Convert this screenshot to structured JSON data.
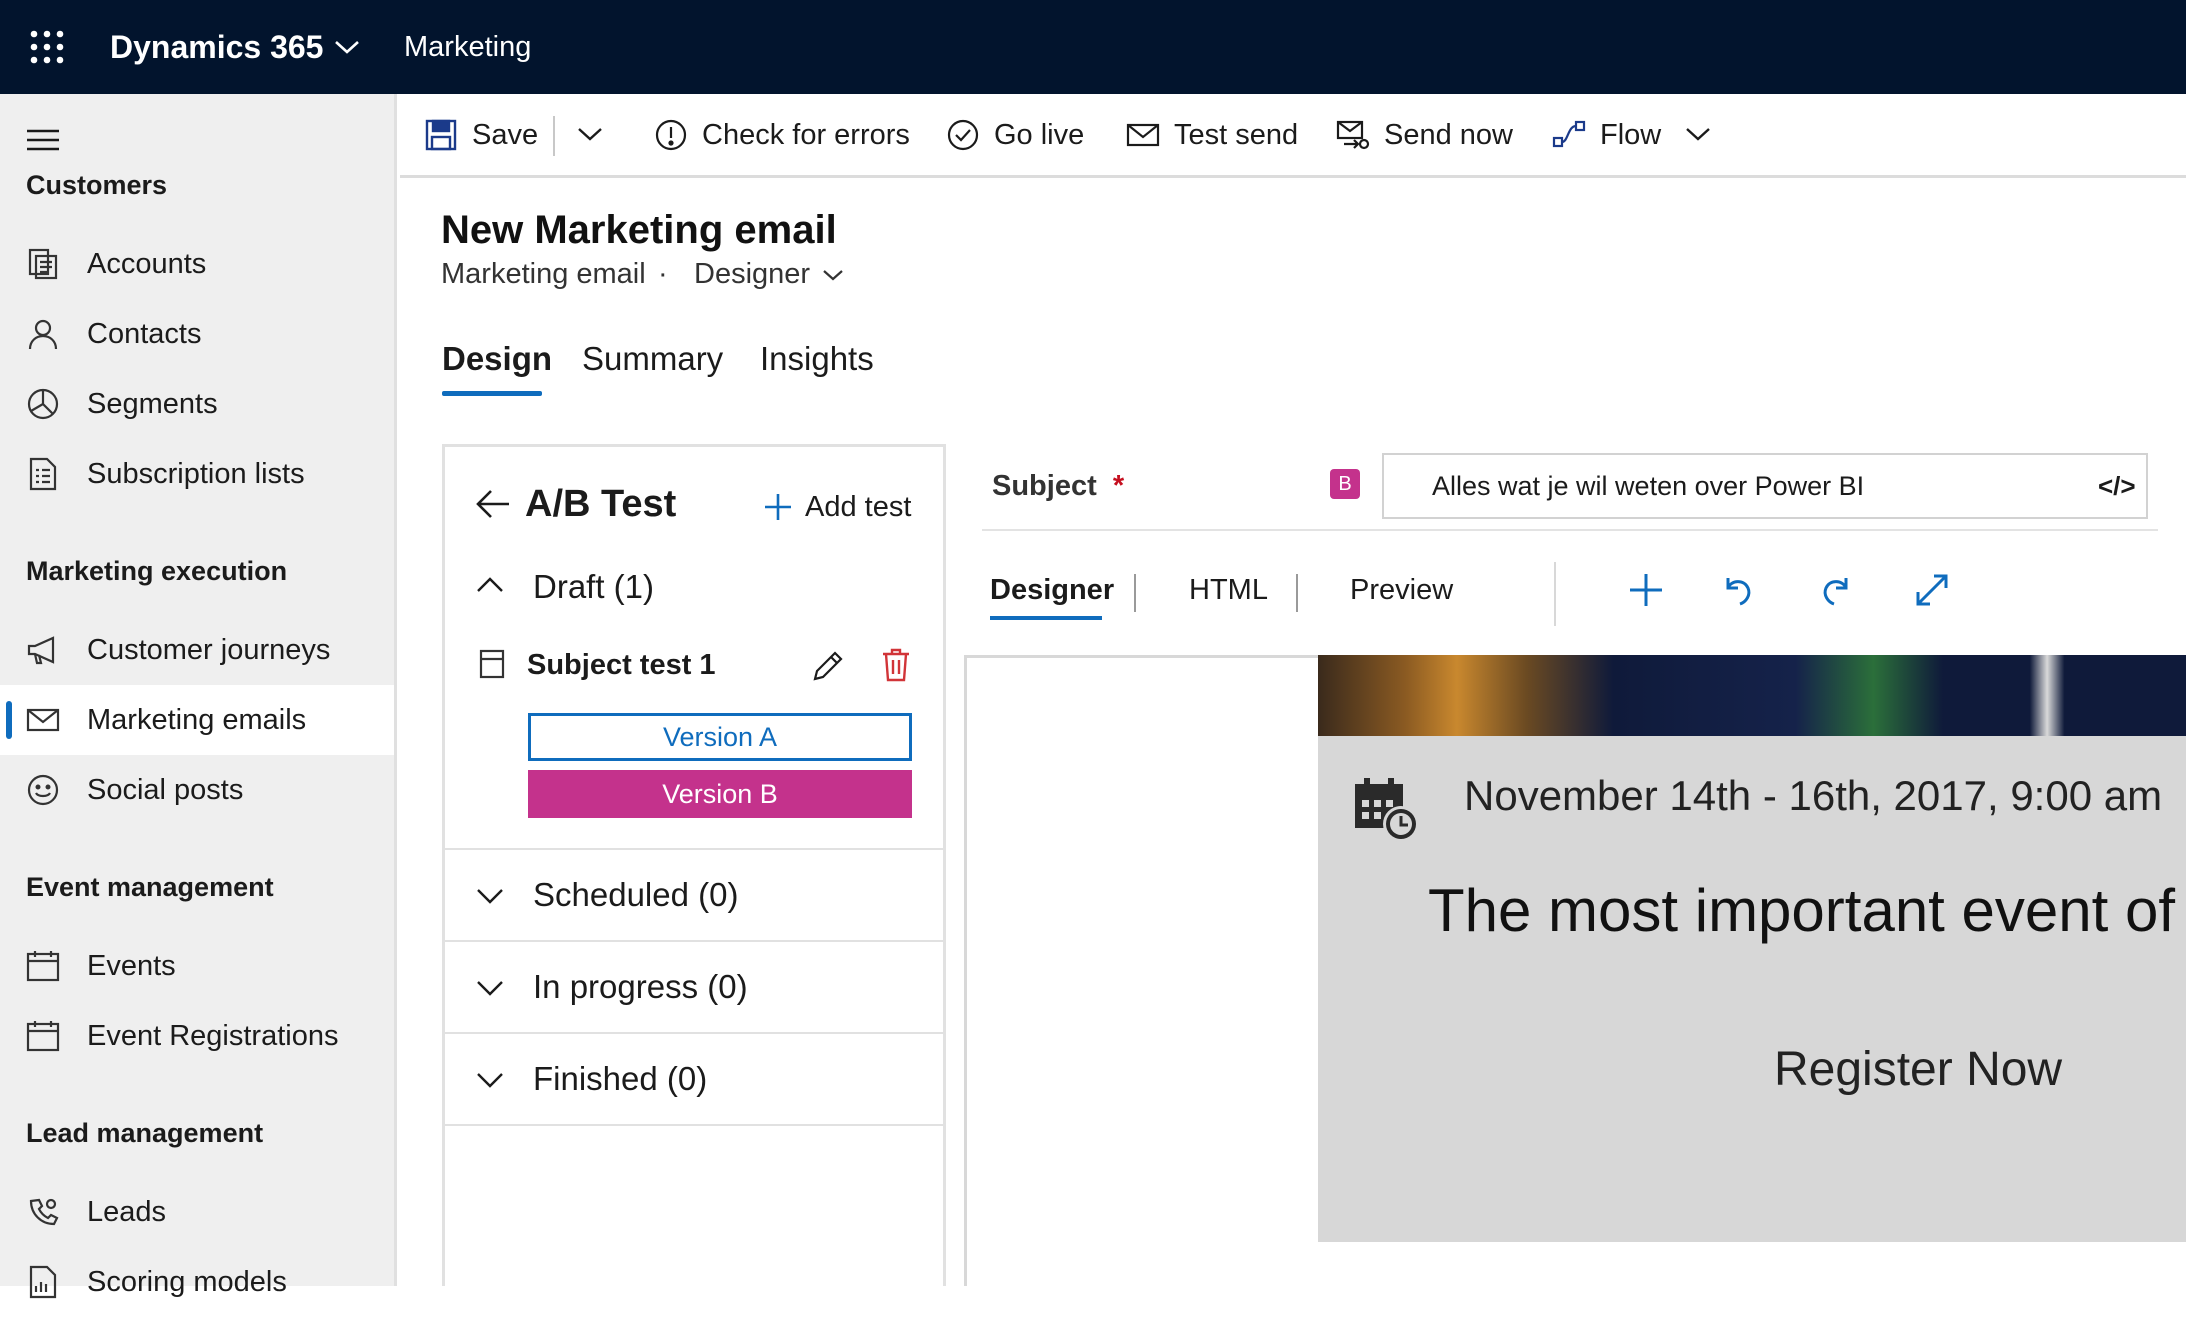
{
  "app": {
    "name": "Dynamics 365",
    "area": "Marketing"
  },
  "sidebar": {
    "groups": [
      {
        "label": "Customers",
        "items": [
          {
            "label": "Accounts",
            "icon": "accounts-icon"
          },
          {
            "label": "Contacts",
            "icon": "person-icon"
          },
          {
            "label": "Segments",
            "icon": "pie-chart-icon"
          },
          {
            "label": "Subscription lists",
            "icon": "list-document-icon"
          }
        ]
      },
      {
        "label": "Marketing execution",
        "items": [
          {
            "label": "Customer journeys",
            "icon": "megaphone-icon"
          },
          {
            "label": "Marketing emails",
            "icon": "mail-icon",
            "selected": true
          },
          {
            "label": "Social posts",
            "icon": "smiley-icon"
          }
        ]
      },
      {
        "label": "Event management",
        "items": [
          {
            "label": "Events",
            "icon": "calendar-icon"
          },
          {
            "label": "Event Registrations",
            "icon": "calendar-icon"
          }
        ]
      },
      {
        "label": "Lead management",
        "items": [
          {
            "label": "Leads",
            "icon": "phone-gear-icon"
          },
          {
            "label": "Scoring models",
            "icon": "document-chart-icon"
          }
        ]
      }
    ]
  },
  "commandbar": {
    "save": "Save",
    "check_errors": "Check for errors",
    "go_live": "Go live",
    "test_send": "Test send",
    "send_now": "Send now",
    "flow": "Flow"
  },
  "header": {
    "title": "New Marketing email",
    "entity": "Marketing email",
    "separator": "·",
    "form": "Designer"
  },
  "tabs": [
    "Design",
    "Summary",
    "Insights"
  ],
  "abtest": {
    "title": "A/B Test",
    "add_test": "Add test",
    "draft": "Draft (1)",
    "test_name": "Subject test 1",
    "version_a": "Version A",
    "version_b": "Version B",
    "scheduled": "Scheduled (0)",
    "in_progress": "In progress (0)",
    "finished": "Finished (0)"
  },
  "editor": {
    "subject_label": "Subject",
    "required_mark": "*",
    "version_badge": "B",
    "subject_value": "Alles wat je wil weten over Power BI",
    "code_icon": "</>",
    "tabs": [
      "Designer",
      "HTML",
      "Preview"
    ],
    "email": {
      "date_line": "November 14th - 16th, 2017, 9:00 am",
      "headline": "The most important event of",
      "cta": "Register Now"
    }
  },
  "colors": {
    "topbar": "#02142d",
    "accent": "#0f6cbd",
    "version_b": "#c4328c",
    "delete": "#d13438"
  }
}
